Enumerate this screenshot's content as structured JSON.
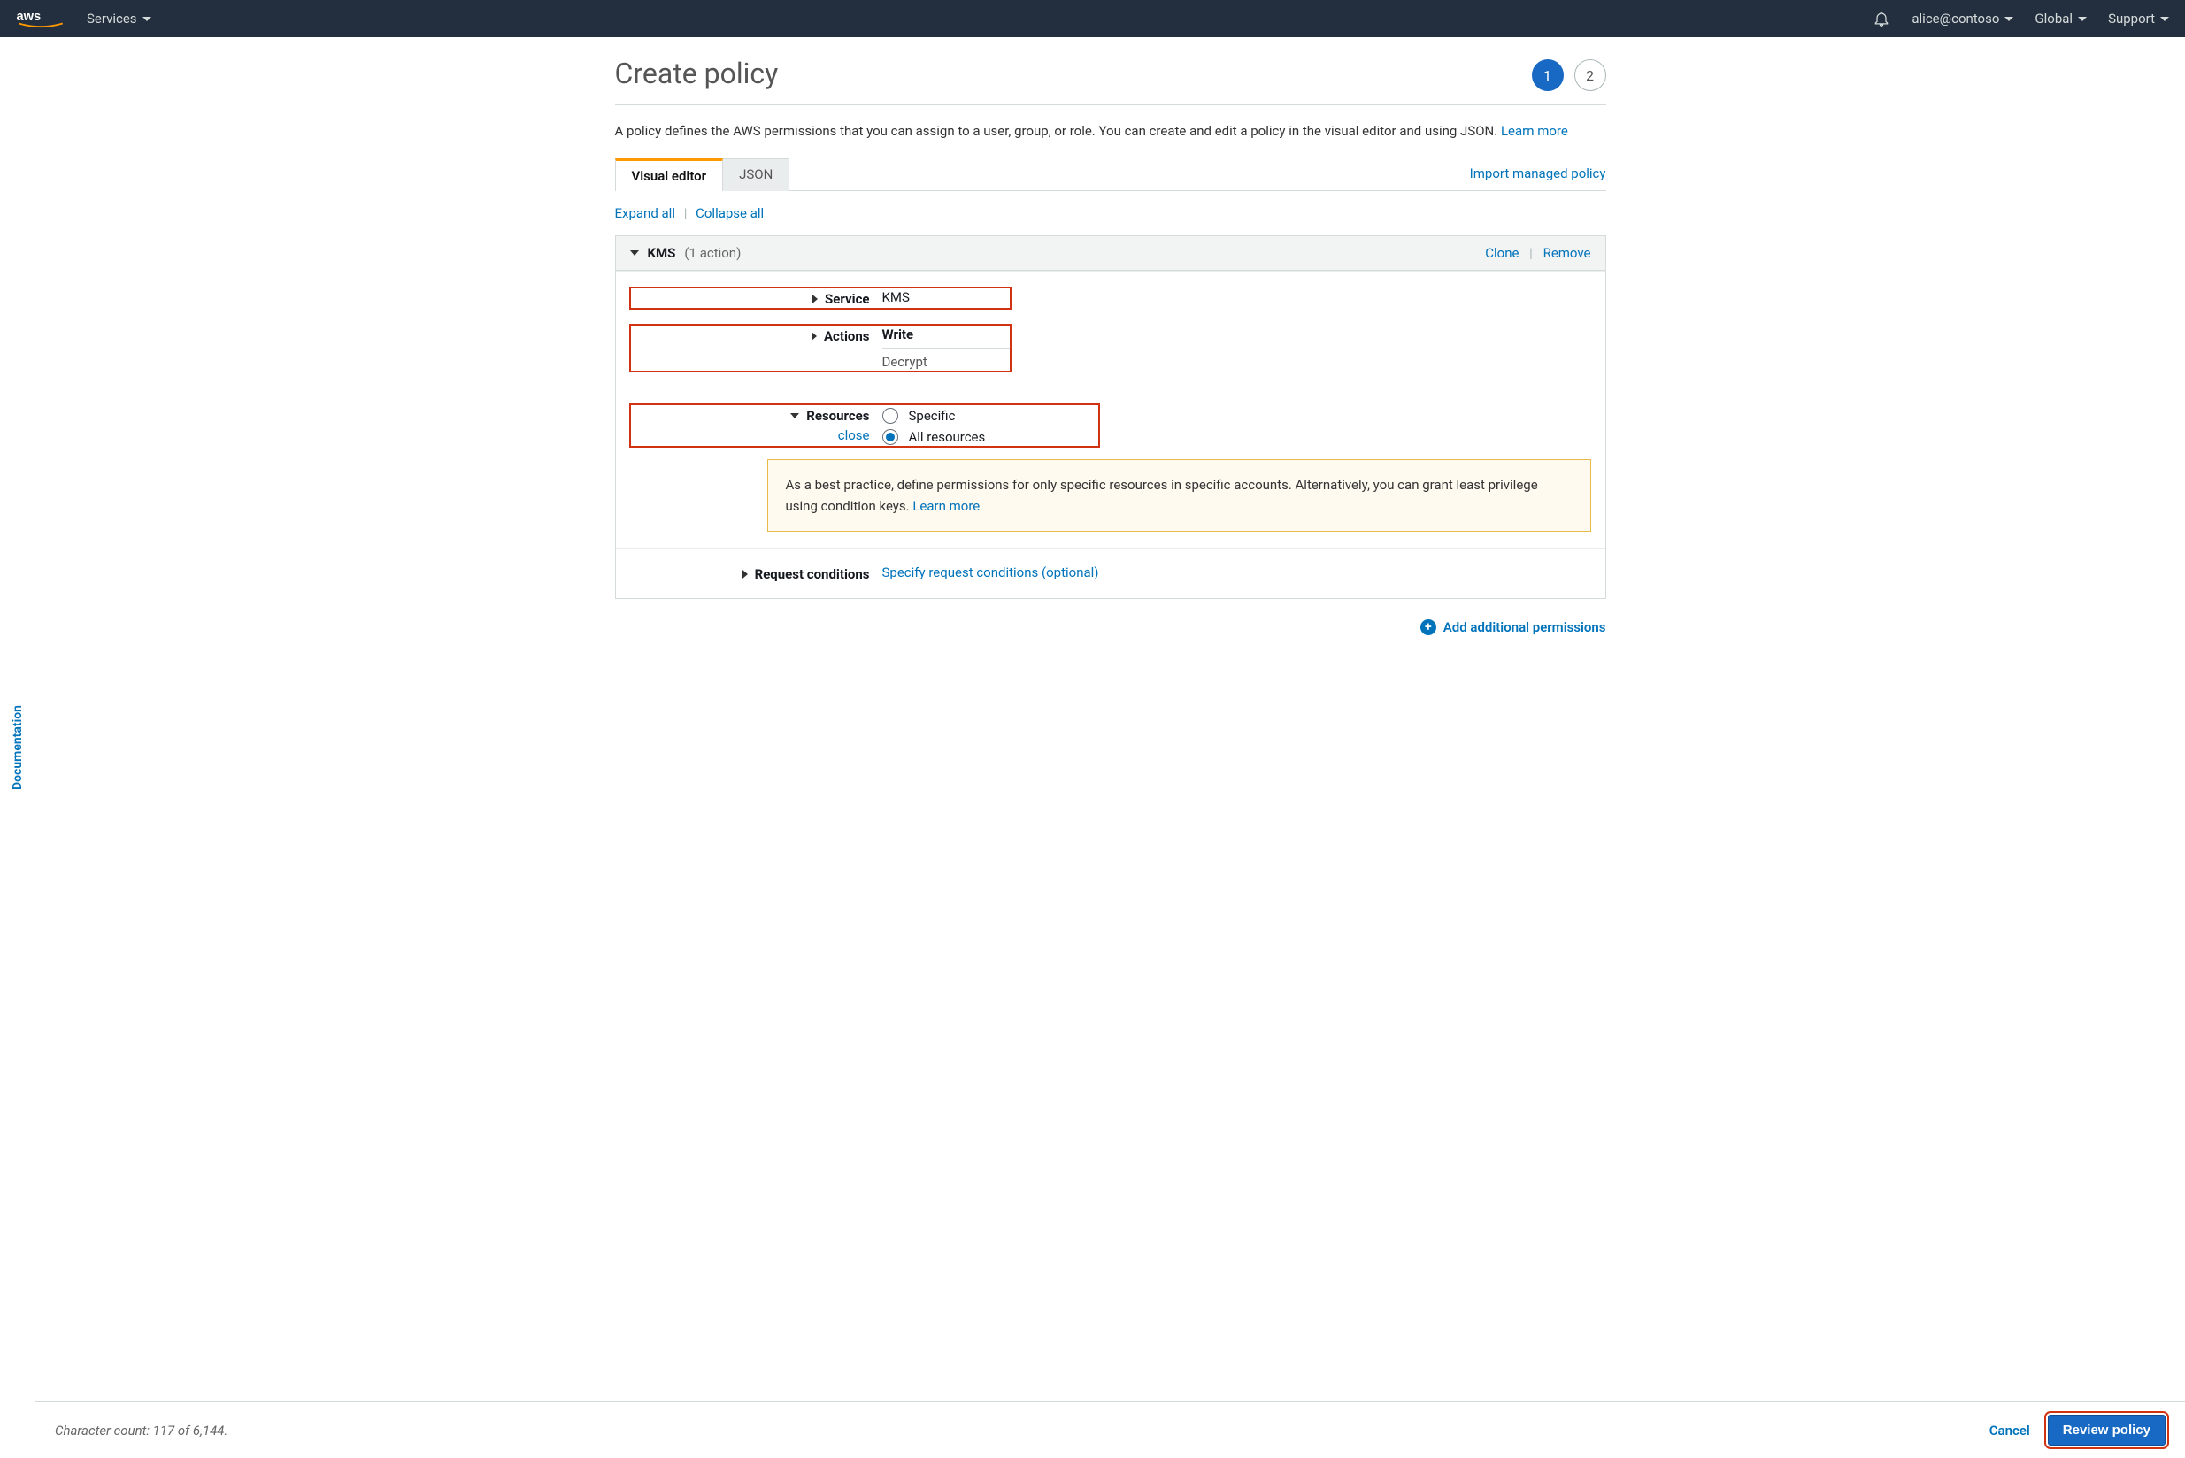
{
  "topnav": {
    "services_label": "Services",
    "account_label": "alice@contoso",
    "region_label": "Global",
    "support_label": "Support"
  },
  "left_rail": {
    "documentation_label": "Documentation"
  },
  "page_title": "Create policy",
  "steps": {
    "step1": "1",
    "step2": "2"
  },
  "description": {
    "text": "A policy defines the AWS permissions that you can assign to a user, group, or role. You can create and edit a policy in the visual editor and using JSON.",
    "learn_more": "Learn more"
  },
  "tabs": {
    "visual_editor": "Visual editor",
    "json": "JSON"
  },
  "import_managed_policy": "Import managed policy",
  "expand_all": "Expand all",
  "collapse_all": "Collapse all",
  "perm": {
    "header": {
      "service": "KMS",
      "count": "(1 action)",
      "clone": "Clone",
      "remove": "Remove"
    },
    "rows": {
      "service": {
        "label": "Service",
        "value": "KMS"
      },
      "actions": {
        "label": "Actions",
        "write": "Write",
        "decrypt": "Decrypt"
      },
      "resources": {
        "label": "Resources",
        "close": "close",
        "specific": "Specific",
        "all": "All resources",
        "best_practice_a": "As a best practice, define permissions for only specific resources in specific accounts. Alternatively, you can grant least privilege using condition keys.",
        "best_practice_learn_more": "Learn more"
      },
      "request_conditions": {
        "label": "Request conditions",
        "value": "Specify request conditions (optional)"
      }
    }
  },
  "add_additional_permissions": "Add additional permissions",
  "footer": {
    "char_count": "Character count: 117 of 6,144.",
    "cancel": "Cancel",
    "review": "Review policy"
  }
}
